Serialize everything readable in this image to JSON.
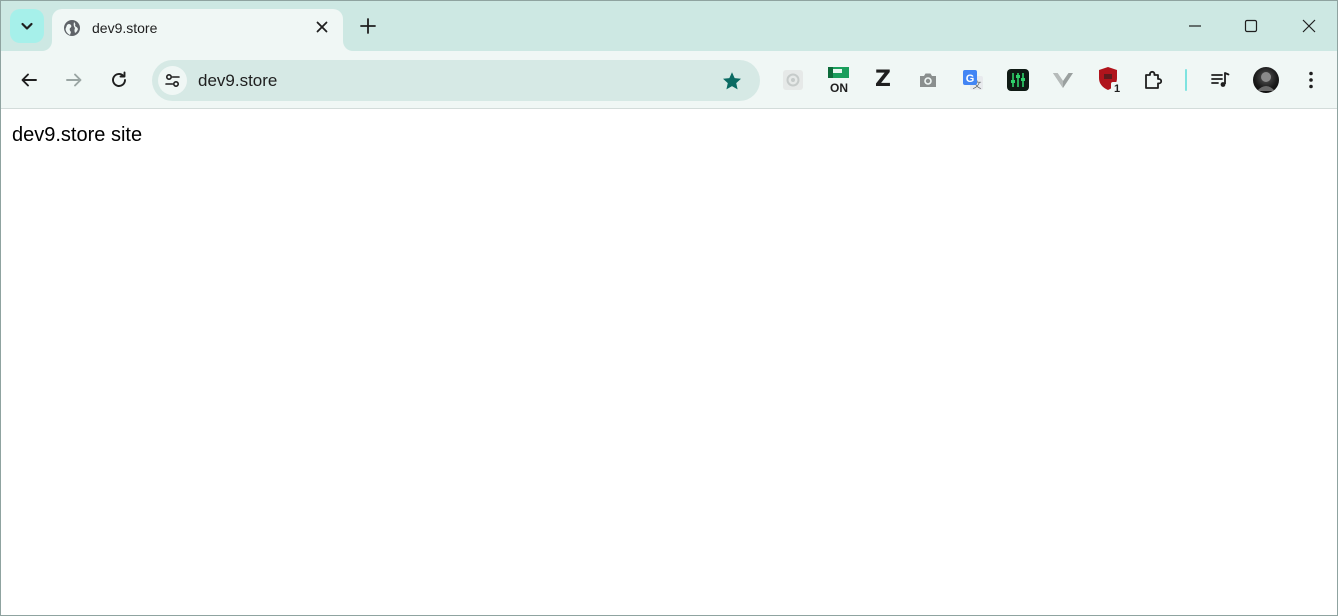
{
  "tab": {
    "title": "dev9.store"
  },
  "omnibox": {
    "url": "dev9.store"
  },
  "page": {
    "text": "dev9.store site"
  },
  "extensions": {
    "on_badge_label": "ON",
    "z_label": "Z",
    "shield_badge": "1"
  },
  "colors": {
    "tabstrip_bg": "#cde8e3",
    "toolbar_bg": "#f0f7f5",
    "omnibox_bg": "#d6e9e5",
    "star_color": "#0b6b63",
    "accent": "#a6f0ea"
  },
  "icons": {
    "tab_search": "chevron-down-icon",
    "favicon": "globe-icon",
    "close": "close-icon",
    "new_tab": "plus-icon",
    "back": "arrow-left-icon",
    "forward": "arrow-right-icon",
    "reload": "reload-icon",
    "site_info": "tune-icon",
    "bookmark": "star-icon",
    "menu": "more-vert-icon"
  }
}
